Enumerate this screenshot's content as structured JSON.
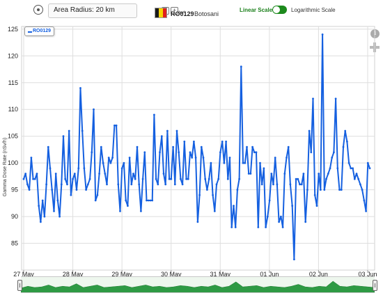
{
  "toolbar": {
    "target_icon": "crosshair-target-icon",
    "area_radius_label": "Area Radius: 20 km",
    "minus_symbol": "−",
    "plus_symbol": "+",
    "station_id": "RO0129",
    "station_name": "Botosani",
    "flag_colors": [
      "#1a1a1a",
      "#f5d400",
      "#e0201b"
    ],
    "linear_scale_label": "Linear Scale",
    "log_scale_label": "Logarithmic Scale",
    "scale_toggle_color": "#1d8a1d"
  },
  "side_icons": {
    "info": "i"
  },
  "legend": {
    "label": "RO0129",
    "color": "#1560e0"
  },
  "chart_data": {
    "type": "line",
    "ylabel": "Gamma Dose Rate (nSv/h)",
    "y_ticks": [
      85,
      90,
      95,
      100,
      105,
      110,
      115,
      120,
      125
    ],
    "ylim": [
      80,
      125.5
    ],
    "x_ticks": [
      "27 May",
      "28 May",
      "29 May",
      "30 May",
      "31 May",
      "01 Jun",
      "02 Jun",
      "03 Jun"
    ],
    "grid": true,
    "legend_placement": "top-left",
    "series": [
      {
        "name": "RO0129",
        "color": "#1560e0",
        "values": [
          97,
          98,
          96,
          95,
          101,
          97,
          97,
          98,
          92,
          89,
          93,
          90,
          96,
          103,
          99,
          95,
          91,
          98,
          93,
          90,
          96,
          105,
          97,
          96,
          106,
          94,
          97,
          98,
          95,
          99,
          114,
          106,
          99,
          95,
          96,
          97,
          102,
          110,
          93,
          94,
          98,
          103,
          100,
          98,
          96,
          101,
          100,
          101,
          107,
          107,
          96,
          91,
          99,
          100,
          93,
          92,
          101,
          96,
          98,
          97,
          103,
          96,
          91,
          97,
          102,
          93,
          93,
          93,
          93,
          109,
          97,
          96,
          102,
          105,
          98,
          96,
          106,
          97,
          97,
          103,
          96,
          106,
          102,
          97,
          96,
          104,
          97,
          97,
          102,
          101,
          104,
          101,
          89,
          94,
          103,
          101,
          97,
          95,
          97,
          100,
          94,
          91,
          96,
          97,
          102,
          104,
          100,
          104,
          97,
          101,
          88,
          92,
          88,
          95,
          97,
          118,
          100,
          100,
          103,
          98,
          98,
          103,
          102,
          102,
          88,
          100,
          96,
          99,
          88,
          90,
          93,
          98,
          96,
          101,
          96,
          89,
          90,
          88,
          98,
          101,
          103,
          96,
          92,
          82,
          97,
          97,
          96,
          96,
          98,
          89,
          95,
          106,
          102,
          112,
          94,
          92,
          98,
          95,
          124,
          95,
          97,
          98,
          99,
          101,
          102,
          112,
          99,
          95,
          95,
          103,
          106,
          104,
          100,
          99,
          99,
          97,
          98,
          97,
          96,
          95,
          93,
          91,
          100,
          99
        ]
      }
    ]
  },
  "navigator": {
    "fill_color": "#2e9a44",
    "levels": [
      0.45,
      0.6,
      0.5,
      0.55,
      0.7,
      0.5,
      0.6,
      0.55,
      0.8,
      0.5,
      0.6,
      0.7,
      0.5,
      0.55,
      0.6,
      0.65,
      0.5,
      0.6,
      0.7,
      0.55,
      0.6,
      0.5,
      0.55,
      0.65,
      0.6,
      0.5,
      0.6,
      0.55,
      0.7,
      0.5,
      0.6,
      0.95,
      0.55,
      0.6,
      0.65,
      0.5,
      0.6,
      0.55,
      0.5,
      0.6,
      0.75,
      0.55,
      0.5,
      0.6,
      0.55,
      1.0,
      0.6,
      0.55,
      0.65,
      0.6,
      0.55,
      0.5
    ]
  }
}
